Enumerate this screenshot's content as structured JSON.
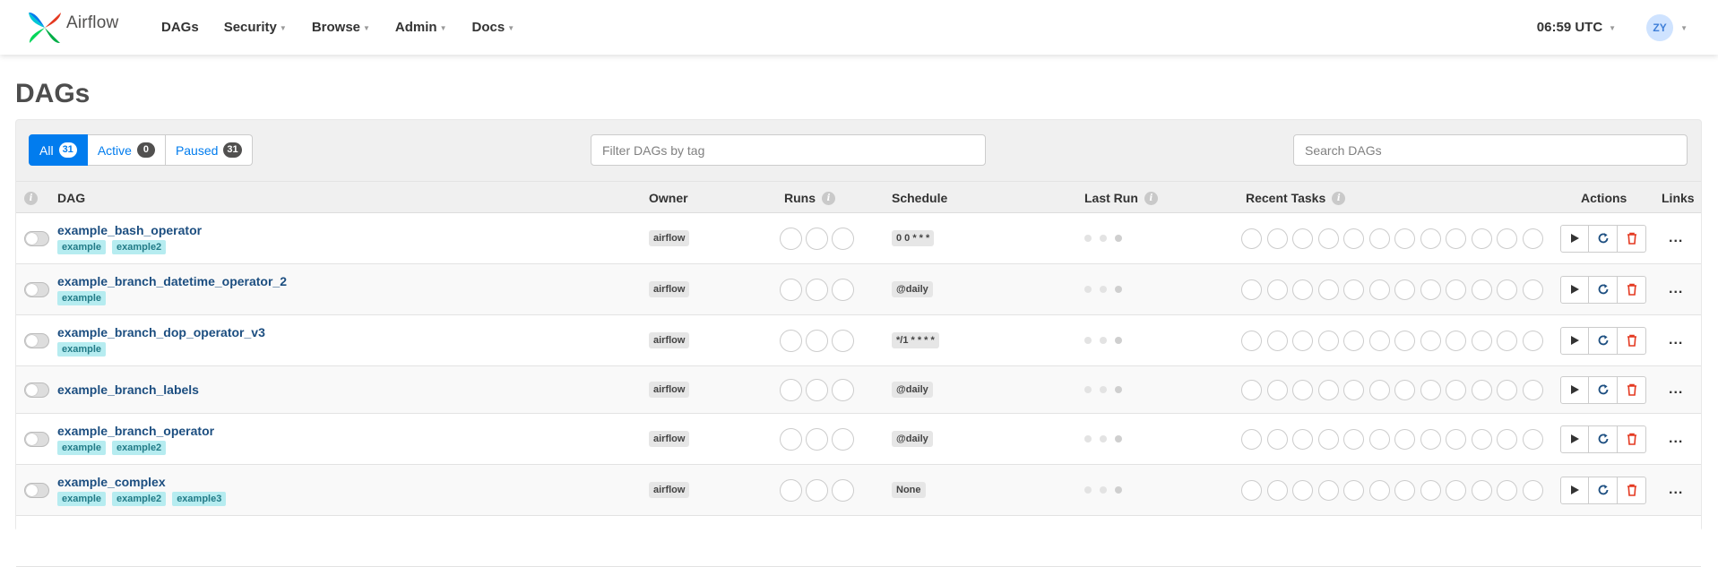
{
  "nav": {
    "brand": "Airflow",
    "menu": [
      {
        "label": "DAGs",
        "dropdown": false
      },
      {
        "label": "Security",
        "dropdown": true
      },
      {
        "label": "Browse",
        "dropdown": true
      },
      {
        "label": "Admin",
        "dropdown": true
      },
      {
        "label": "Docs",
        "dropdown": true
      }
    ],
    "clock": "06:59 UTC",
    "user_initials": "ZY"
  },
  "page_title": "DAGs",
  "filters": [
    {
      "label": "All",
      "count": "31",
      "active": true
    },
    {
      "label": "Active",
      "count": "0",
      "active": false
    },
    {
      "label": "Paused",
      "count": "31",
      "active": false
    }
  ],
  "tag_filter_placeholder": "Filter DAGs by tag",
  "search_placeholder": "Search DAGs",
  "columns": {
    "dag": "DAG",
    "owner": "Owner",
    "runs": "Runs",
    "schedule": "Schedule",
    "last_run": "Last Run",
    "recent_tasks": "Recent Tasks",
    "actions": "Actions",
    "links": "Links"
  },
  "dags": [
    {
      "name": "example_bash_operator",
      "tags": [
        "example",
        "example2"
      ],
      "owner": "airflow",
      "schedule": "0 0 * * *"
    },
    {
      "name": "example_branch_datetime_operator_2",
      "tags": [
        "example"
      ],
      "owner": "airflow",
      "schedule": "@daily"
    },
    {
      "name": "example_branch_dop_operator_v3",
      "tags": [
        "example"
      ],
      "owner": "airflow",
      "schedule": "*/1 * * * *"
    },
    {
      "name": "example_branch_labels",
      "tags": [],
      "owner": "airflow",
      "schedule": "@daily"
    },
    {
      "name": "example_branch_operator",
      "tags": [
        "example",
        "example2"
      ],
      "owner": "airflow",
      "schedule": "@daily"
    },
    {
      "name": "example_complex",
      "tags": [
        "example",
        "example2",
        "example3"
      ],
      "owner": "airflow",
      "schedule": "None"
    }
  ],
  "links_label": "...",
  "colors": {
    "accent": "#017cee",
    "dag_link": "#1c4e80",
    "tag_bg": "#b6ecf0",
    "tag_text": "#227b87",
    "delete": "#e43921",
    "logo_red": "#e43921",
    "logo_green": "#00ad46",
    "logo_blue": "#017cee",
    "logo_teal": "#04d659"
  }
}
